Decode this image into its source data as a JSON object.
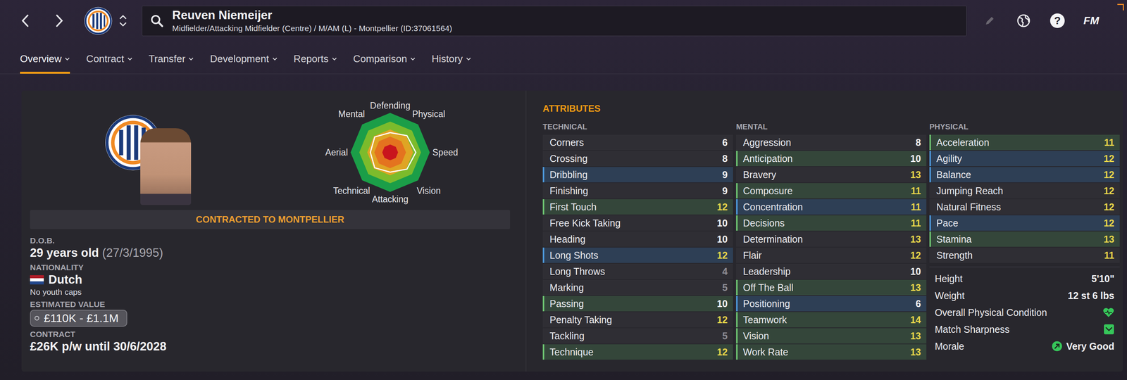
{
  "window": {
    "title": "Reuven Niemeijer",
    "subtitle": "Midfielder/Attacking Midfielder (Centre) / M/AM (L) - Montpellier (ID:37061564)"
  },
  "toolbar": {
    "help": "?",
    "logo": "FM"
  },
  "tabs": [
    {
      "label": "Overview",
      "selected": true
    },
    {
      "label": "Contract",
      "selected": false
    },
    {
      "label": "Transfer",
      "selected": false
    },
    {
      "label": "Development",
      "selected": false
    },
    {
      "label": "Reports",
      "selected": false
    },
    {
      "label": "Comparison",
      "selected": false
    },
    {
      "label": "History",
      "selected": false
    }
  ],
  "radar": {
    "axes": [
      "Defending",
      "Physical",
      "Speed",
      "Vision",
      "Attacking",
      "Technical",
      "Aerial",
      "Mental"
    ],
    "values": [
      10,
      12,
      13,
      12,
      10,
      11,
      10,
      11
    ]
  },
  "status_banner": "CONTRACTED TO MONTPELLIER",
  "info": {
    "dob": {
      "label": "D.O.B.",
      "value": "29 years old",
      "extra": "(27/3/1995)"
    },
    "nationality": {
      "label": "NATIONALITY",
      "value": "Dutch",
      "note": "No youth caps"
    },
    "estimated_value": {
      "label": "ESTIMATED VALUE",
      "value": "£110K - £1.1M"
    },
    "contract": {
      "label": "CONTRACT",
      "value": "£26K p/w until 30/6/2028"
    }
  },
  "attributes": {
    "title": "ATTRIBUTES",
    "groups": [
      {
        "title": "TECHNICAL",
        "rows": [
          {
            "name": "Corners",
            "value": "6",
            "highlight": "none"
          },
          {
            "name": "Crossing",
            "value": "8",
            "highlight": "none"
          },
          {
            "name": "Dribbling",
            "value": "9",
            "highlight": "blue"
          },
          {
            "name": "Finishing",
            "value": "9",
            "highlight": "none"
          },
          {
            "name": "First Touch",
            "value": "12",
            "highlight": "green"
          },
          {
            "name": "Free Kick Taking",
            "value": "10",
            "highlight": "none"
          },
          {
            "name": "Heading",
            "value": "10",
            "highlight": "none"
          },
          {
            "name": "Long Shots",
            "value": "12",
            "highlight": "blue"
          },
          {
            "name": "Long Throws",
            "value": "4",
            "highlight": "none"
          },
          {
            "name": "Marking",
            "value": "5",
            "highlight": "none"
          },
          {
            "name": "Passing",
            "value": "10",
            "highlight": "green"
          },
          {
            "name": "Penalty Taking",
            "value": "12",
            "highlight": "none"
          },
          {
            "name": "Tackling",
            "value": "5",
            "highlight": "none"
          },
          {
            "name": "Technique",
            "value": "12",
            "highlight": "green"
          }
        ]
      },
      {
        "title": "MENTAL",
        "rows": [
          {
            "name": "Aggression",
            "value": "8",
            "highlight": "none"
          },
          {
            "name": "Anticipation",
            "value": "10",
            "highlight": "green"
          },
          {
            "name": "Bravery",
            "value": "13",
            "highlight": "none"
          },
          {
            "name": "Composure",
            "value": "11",
            "highlight": "green"
          },
          {
            "name": "Concentration",
            "value": "11",
            "highlight": "blue"
          },
          {
            "name": "Decisions",
            "value": "11",
            "highlight": "green"
          },
          {
            "name": "Determination",
            "value": "13",
            "highlight": "none"
          },
          {
            "name": "Flair",
            "value": "12",
            "highlight": "none"
          },
          {
            "name": "Leadership",
            "value": "10",
            "highlight": "none"
          },
          {
            "name": "Off The Ball",
            "value": "13",
            "highlight": "green"
          },
          {
            "name": "Positioning",
            "value": "6",
            "highlight": "blue"
          },
          {
            "name": "Teamwork",
            "value": "14",
            "highlight": "green"
          },
          {
            "name": "Vision",
            "value": "13",
            "highlight": "green"
          },
          {
            "name": "Work Rate",
            "value": "13",
            "highlight": "green"
          }
        ]
      },
      {
        "title": "PHYSICAL",
        "rows": [
          {
            "name": "Acceleration",
            "value": "11",
            "highlight": "green"
          },
          {
            "name": "Agility",
            "value": "12",
            "highlight": "blue"
          },
          {
            "name": "Balance",
            "value": "12",
            "highlight": "blue"
          },
          {
            "name": "Jumping Reach",
            "value": "12",
            "highlight": "none"
          },
          {
            "name": "Natural Fitness",
            "value": "12",
            "highlight": "none"
          },
          {
            "name": "Pace",
            "value": "12",
            "highlight": "blue"
          },
          {
            "name": "Stamina",
            "value": "13",
            "highlight": "green"
          },
          {
            "name": "Strength",
            "value": "11",
            "highlight": "none"
          }
        ]
      }
    ]
  },
  "physical_info": [
    {
      "label": "Height",
      "kind": "text",
      "value": "5'10\""
    },
    {
      "label": "Weight",
      "kind": "text",
      "value": "12 st 6 lbs"
    },
    {
      "label": "Overall Physical Condition",
      "kind": "condition",
      "value": ""
    },
    {
      "label": "Match Sharpness",
      "kind": "sharpness",
      "value": ""
    },
    {
      "label": "Morale",
      "kind": "morale",
      "value": "Very Good"
    }
  ]
}
